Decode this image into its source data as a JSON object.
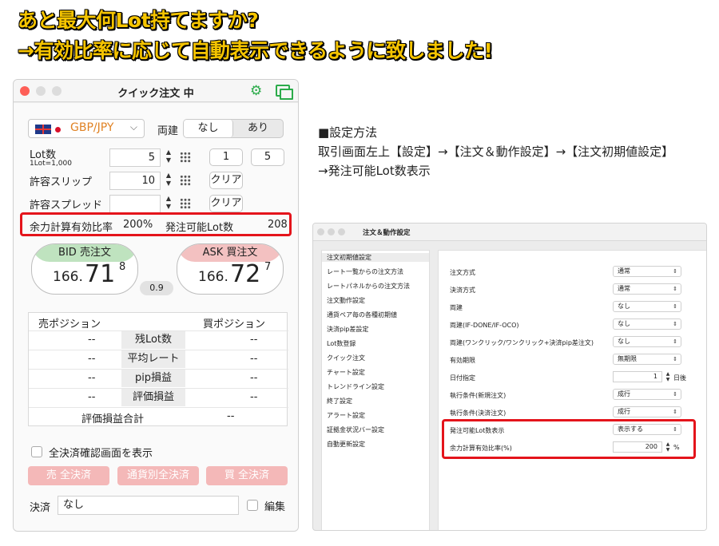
{
  "headline": {
    "line1": "あと最大何Lot持てますか?",
    "line2": "→有効比率に応じて自動表示できるように致しました!"
  },
  "quick_order": {
    "title": "クイック注文 中",
    "pair": "GBP/JPY",
    "hedge_label": "両建",
    "hedge_options": [
      "なし",
      "あり"
    ],
    "lot_label": "Lot数",
    "lot_sub": "1Lot=1,000",
    "lot_value": "5",
    "lot_preset1": "1",
    "lot_preset2": "5",
    "slip_label": "許容スリップ",
    "slip_value": "10",
    "slip_clear": "クリア",
    "spread_label": "許容スプレッド",
    "spread_value": "",
    "spread_clear": "クリア",
    "margin_label": "余力計算有効比率",
    "margin_value": "200%",
    "orderable_label": "発注可能Lot数",
    "orderable_value": "208",
    "bid_label": "BID 売注文",
    "bid_prefix": "166.",
    "bid_big": "71",
    "bid_pip": "8",
    "ask_label": "ASK 買注文",
    "ask_prefix": "166.",
    "ask_big": "72",
    "ask_pip": "7",
    "spread_badge": "0.9",
    "positions": {
      "sell_header": "売ポジション",
      "buy_header": "買ポジション",
      "rows": [
        {
          "label": "残Lot数",
          "sell": "--",
          "buy": "--"
        },
        {
          "label": "平均レート",
          "sell": "--",
          "buy": "--"
        },
        {
          "label": "pip損益",
          "sell": "--",
          "buy": "--"
        },
        {
          "label": "評価損益",
          "sell": "--",
          "buy": "--"
        }
      ],
      "total_label": "評価損益合計",
      "total_value": "--"
    },
    "confirm_label": "全決済確認画面を表示",
    "btn_sell_all": "売 全決済",
    "btn_currency_all": "通貨別全決済",
    "btn_buy_all": "買 全決済",
    "settle_label": "決済",
    "settle_value": "なし",
    "edit_label": "編集"
  },
  "instructions": {
    "line1": "■設定方法",
    "line2": "取引画面左上【設定】→【注文＆動作設定】→【注文初期値設定】",
    "line3": "→発注可能Lot数表示"
  },
  "settings_window": {
    "title": "注文＆動作設定",
    "sidebar": [
      "注文初期値設定",
      "レート一覧からの注文方法",
      "レートパネルからの注文方法",
      "注文動作設定",
      "通貨ペア毎の各種初期値",
      "決済pip差設定",
      "Lot数登録",
      "クイック注文",
      "チャート設定",
      "トレンドライン設定",
      "終了設定",
      "アラート設定",
      "証拠金状況バー設定",
      "自動更新設定"
    ],
    "fields": [
      {
        "label": "注文方式",
        "value": "通常",
        "kind": "select"
      },
      {
        "label": "決済方式",
        "value": "通常",
        "kind": "select"
      },
      {
        "label": "両建",
        "value": "なし",
        "kind": "select"
      },
      {
        "label": "両建(IF-DONE/IF-OCO)",
        "value": "なし",
        "kind": "select"
      },
      {
        "label": "両建(ワンクリック/ワンクリック+決済pip差注文)",
        "value": "なし",
        "kind": "select"
      },
      {
        "label": "有効期限",
        "value": "無期限",
        "kind": "select"
      },
      {
        "label": "日付指定",
        "value": "1",
        "kind": "number",
        "unit": "日後"
      },
      {
        "label": "執行条件(新規注文)",
        "value": "成行",
        "kind": "select"
      },
      {
        "label": "執行条件(決済注文)",
        "value": "成行",
        "kind": "select"
      },
      {
        "label": "発注可能Lot数表示",
        "value": "表示する",
        "kind": "select"
      },
      {
        "label": "余力計算有効比率(%)",
        "value": "200",
        "kind": "number",
        "unit": "%"
      }
    ]
  },
  "colors": {
    "headline": "#f5c400",
    "highlight": "#e4141b",
    "bid": "#bfe3bf",
    "ask": "#f3c1c1",
    "accent_green": "#2bab4a",
    "pair_text": "#e08224"
  }
}
